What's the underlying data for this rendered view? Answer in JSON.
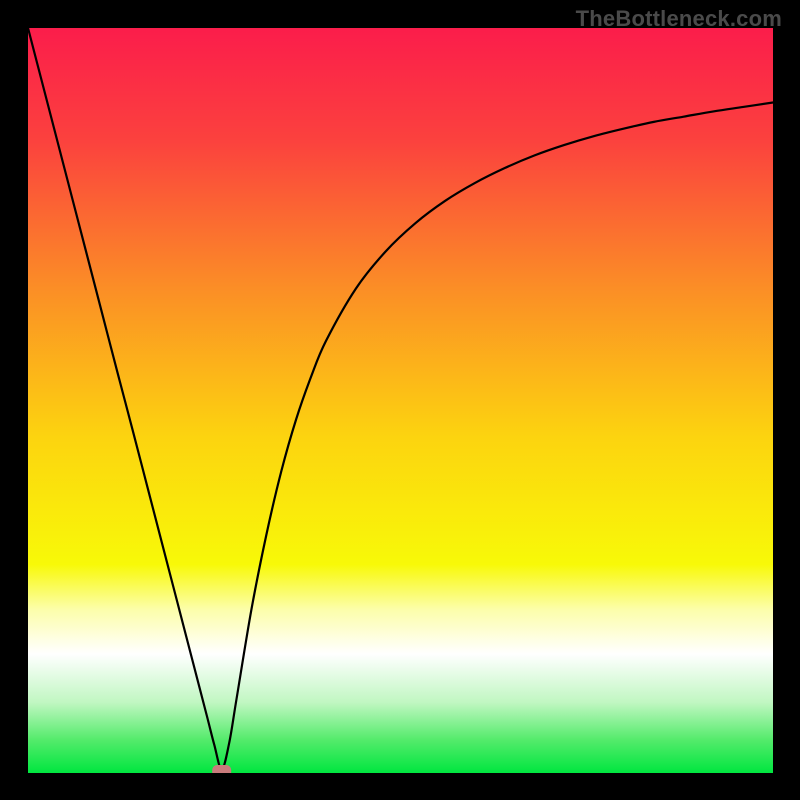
{
  "watermark": "TheBottleneck.com",
  "chart_data": {
    "type": "line",
    "title": "",
    "xlabel": "",
    "ylabel": "",
    "xlim": [
      0,
      100
    ],
    "ylim": [
      0,
      100
    ],
    "legend": false,
    "grid": false,
    "minimum_marker": {
      "x": 26,
      "y": 0,
      "color": "#c97b7c",
      "shape": "rounded-rect"
    },
    "background_gradient": {
      "stops": [
        {
          "offset": 0.0,
          "color": "#fb1d4b"
        },
        {
          "offset": 0.15,
          "color": "#fb413e"
        },
        {
          "offset": 0.35,
          "color": "#fb8e26"
        },
        {
          "offset": 0.55,
          "color": "#fcd40f"
        },
        {
          "offset": 0.72,
          "color": "#f8f908"
        },
        {
          "offset": 0.78,
          "color": "#fcfea9"
        },
        {
          "offset": 0.84,
          "color": "#ffffff"
        },
        {
          "offset": 0.905,
          "color": "#c1f7c2"
        },
        {
          "offset": 0.955,
          "color": "#55eb6c"
        },
        {
          "offset": 1.0,
          "color": "#00e63f"
        }
      ]
    },
    "series": [
      {
        "name": "curve",
        "color": "#000000",
        "x": [
          0,
          2,
          4,
          6,
          8,
          10,
          12,
          14,
          16,
          18,
          20,
          22,
          24,
          25,
          26,
          27,
          28,
          30,
          32,
          34,
          36,
          38,
          40,
          44,
          48,
          52,
          56,
          60,
          64,
          68,
          72,
          76,
          80,
          84,
          88,
          92,
          96,
          100
        ],
        "y": [
          100,
          92.3,
          84.6,
          76.9,
          69.2,
          61.5,
          53.8,
          46.2,
          38.5,
          30.8,
          23.1,
          15.4,
          7.7,
          3.8,
          0.5,
          4.0,
          10.0,
          22.0,
          32.0,
          40.5,
          47.5,
          53.2,
          58.0,
          65.0,
          70.0,
          73.8,
          76.8,
          79.2,
          81.2,
          82.9,
          84.3,
          85.5,
          86.5,
          87.4,
          88.1,
          88.8,
          89.4,
          90.0
        ]
      }
    ]
  }
}
